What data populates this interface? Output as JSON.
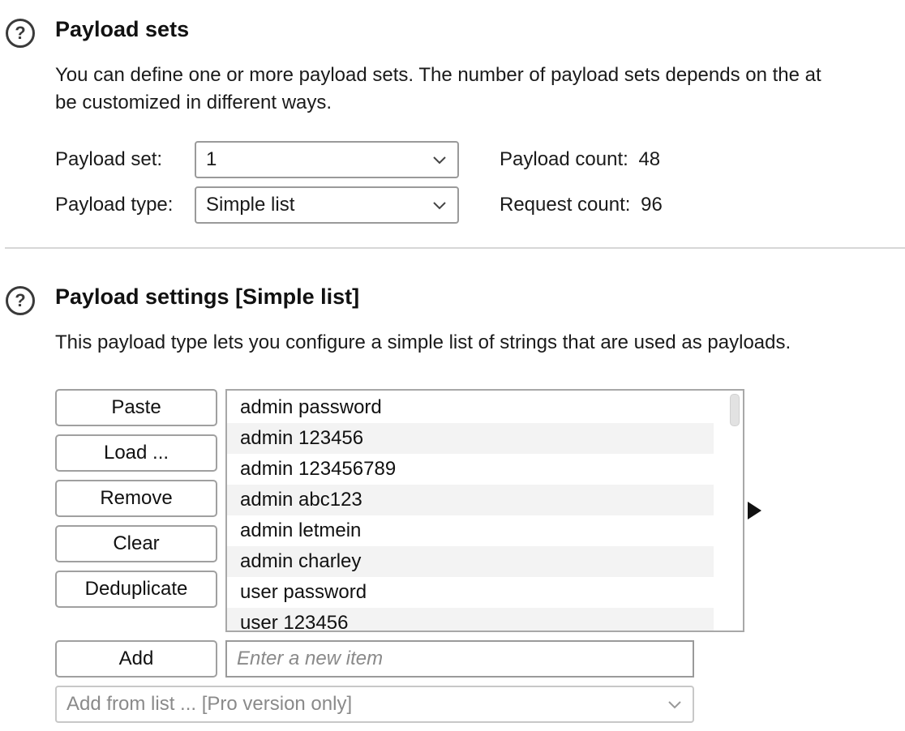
{
  "payload_sets": {
    "title": "Payload sets",
    "description_line1": "You can define one or more payload sets. The number of payload sets depends on the at",
    "description_line2": "be customized in different ways.",
    "payload_set_label": "Payload set:",
    "payload_set_value": "1",
    "payload_type_label": "Payload type:",
    "payload_type_value": "Simple list",
    "payload_count_label": "Payload count:",
    "payload_count_value": "48",
    "request_count_label": "Request count:",
    "request_count_value": "96"
  },
  "payload_settings": {
    "title": "Payload settings [Simple list]",
    "description": "This payload type lets you configure a simple list of strings that are used as payloads.",
    "buttons": {
      "paste": "Paste",
      "load": "Load ...",
      "remove": "Remove",
      "clear": "Clear",
      "deduplicate": "Deduplicate",
      "add": "Add"
    },
    "items": [
      "admin password",
      "admin 123456",
      "admin 123456789",
      "admin abc123",
      "admin letmein",
      "admin charley",
      "user password",
      "user 123456"
    ],
    "new_item_placeholder": "Enter a new item",
    "add_from_list": "Add from list ... [Pro version only]"
  },
  "icons": {
    "help": "help-circle-icon",
    "dropdown": "chevron-down-icon",
    "expand": "triangle-right-icon"
  },
  "colors": {
    "border": "#9a9a9a",
    "alt_row": "#f3f3f3",
    "placeholder": "#8a8a8a"
  }
}
